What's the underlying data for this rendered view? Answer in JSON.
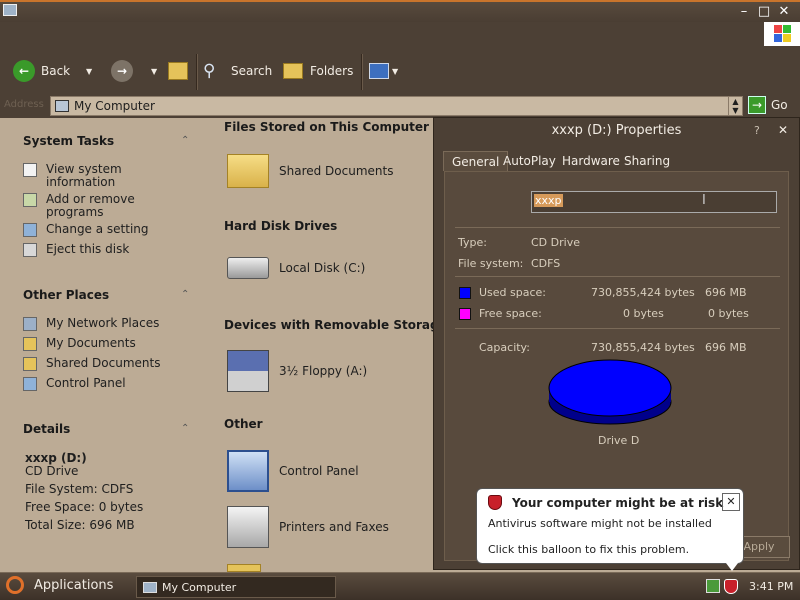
{
  "window": {
    "title_icon": "computer-icon",
    "minimize": "–",
    "maximize": "□",
    "close": "✕"
  },
  "toolbar": {
    "back_label": "Back",
    "search_label": "Search",
    "folders_label": "Folders"
  },
  "address": {
    "label": "Address",
    "value": "My Computer",
    "go_label": "Go"
  },
  "left_pane": {
    "system_tasks": {
      "title": "System Tasks",
      "items": [
        {
          "label_line1": "View system",
          "label_line2": "information"
        },
        {
          "label_line1": "Add or remove",
          "label_line2": "programs"
        },
        {
          "label_line1": "Change a setting",
          "label_line2": ""
        },
        {
          "label_line1": "Eject this disk",
          "label_line2": ""
        }
      ]
    },
    "other_places": {
      "title": "Other Places",
      "items": [
        "My Network Places",
        "My Documents",
        "Shared Documents",
        "Control Panel"
      ]
    },
    "details": {
      "title": "Details",
      "name": "xxxp (D:)",
      "type": "CD Drive",
      "filesystem": "File System: CDFS",
      "free": "Free Space: 0 bytes",
      "total": "Total Size: 696 MB"
    }
  },
  "main_pane": {
    "groups": [
      {
        "title": "Files Stored on This Computer",
        "items": [
          "Shared Documents"
        ]
      },
      {
        "title": "Hard Disk Drives",
        "items": [
          "Local Disk (C:)"
        ]
      },
      {
        "title": "Devices with Removable Storage",
        "items": [
          "3½ Floppy (A:)"
        ]
      },
      {
        "title": "Other",
        "items": [
          "Control Panel",
          "Printers and Faxes"
        ]
      }
    ]
  },
  "dialog": {
    "title": "xxxp (D:) Properties",
    "help": "?",
    "close": "✕",
    "tabs": [
      "General",
      "AutoPlay",
      "Hardware",
      "Sharing"
    ],
    "label_value": "xxxp",
    "type_label": "Type:",
    "type_value": "CD Drive",
    "fs_label": "File system:",
    "fs_value": "CDFS",
    "used_label": "Used space:",
    "used_bytes": "730,855,424 bytes",
    "used_size": "696 MB",
    "free_label": "Free space:",
    "free_bytes": "0 bytes",
    "free_size": "0 bytes",
    "capacity_label": "Capacity:",
    "capacity_bytes": "730,855,424 bytes",
    "capacity_size": "696 MB",
    "drive_label": "Drive D",
    "apply_label": "Apply",
    "used_color": "#0000ff",
    "free_color": "#ff00ff"
  },
  "balloon": {
    "title": "Your computer might be at risk",
    "line1": "Antivirus software might not be installed",
    "line2": "Click this balloon to fix this problem."
  },
  "taskbar": {
    "applications_label": "Applications",
    "task_label": "My Computer",
    "clock": "3:41 PM"
  }
}
